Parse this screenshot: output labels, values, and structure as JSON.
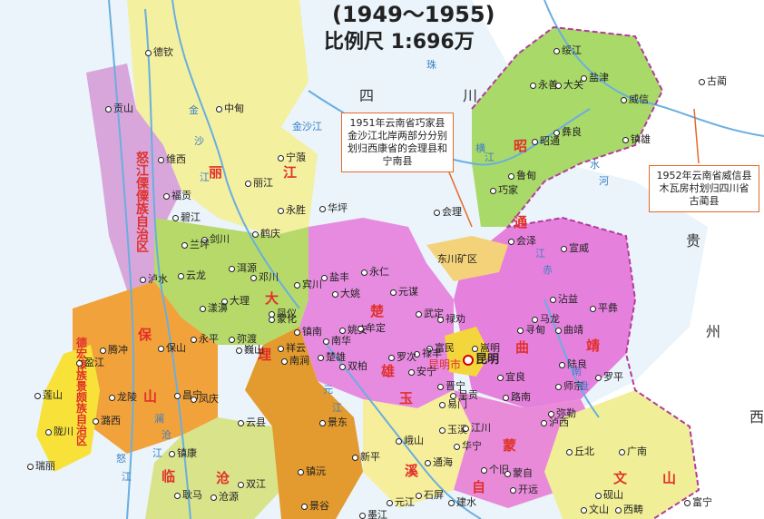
{
  "title": "(1949～1955)",
  "scale": "比例尺 1:696万",
  "notes": {
    "qiaojia": "1951年云南省巧家县金沙江北岸两部分分别划归西康省的会理县和宁南县",
    "weixin": "1952年云南省威信县木瓦房村划归四川省古蔺县"
  },
  "capital": "昆明",
  "regions": {
    "sichuan_si": "四",
    "sichuan_chuan": "川",
    "guizhou_gui": "贵",
    "guizhou_zhou": "州",
    "guangxi_xi": "西",
    "dongchuan": "东川矿区",
    "kunming_shi": "昆明市"
  },
  "district_chars": {
    "lijiang_li": "丽",
    "lijiang_jiang": "江",
    "nujiang": "怒江傈僳族自治区",
    "dali_da": "大",
    "dali_li": "理",
    "baoshan_bao": "保",
    "baoshan_shan": "山",
    "chuxiong_chu": "楚",
    "chuxiong_xiong": "雄",
    "zhaotong_zhao": "昭",
    "zhaotong_tong": "通",
    "qujing_qu": "曲",
    "qujing_jing": "靖",
    "yuxi_yu": "玉",
    "yuxi_xi": "溪",
    "mengzi_meng": "蒙",
    "mengzi_zi": "自",
    "wenshan_wen": "文",
    "wenshan_shan": "山",
    "lincang_lin": "临",
    "lincang_cang": "沧",
    "dehong": "德宏傣族景颇族自治区"
  },
  "counties": [
    "德钦",
    "中甸",
    "维西",
    "丽江",
    "宁蒗",
    "华坪",
    "永胜",
    "鹤庆",
    "剑川",
    "兰坪",
    "碧江",
    "福贡",
    "贡山",
    "泸水",
    "云龙",
    "洱源",
    "邓川",
    "宾川",
    "永仁",
    "大姚",
    "盐丰",
    "姚安",
    "牟定",
    "元谋",
    "武定",
    "禄劝",
    "大理",
    "漾濞",
    "凤仪",
    "祥云",
    "弥渡",
    "巍山",
    "永平",
    "保山",
    "腾冲",
    "龙陵",
    "盈江",
    "莲山",
    "陇川",
    "潞西",
    "瑞丽",
    "昌宁",
    "凤庆",
    "云县",
    "镇康",
    "耿马",
    "沧源",
    "双江",
    "景东",
    "镇沅",
    "景谷",
    "新平",
    "元江",
    "墨江",
    "峨山",
    "玉溪",
    "江川",
    "华宁",
    "通海",
    "建水",
    "石屏",
    "开远",
    "个旧",
    "蒙自",
    "弥勒",
    "路南",
    "宜良",
    "呈贡",
    "晋宁",
    "安宁",
    "富民",
    "嵩明",
    "寻甸",
    "马龙",
    "曲靖",
    "陆良",
    "罗平",
    "师宗",
    "泸西",
    "丘北",
    "广南",
    "砚山",
    "文山",
    "西畴",
    "富宁",
    "会泽",
    "巧家",
    "鲁甸",
    "昭通",
    "永善",
    "大关",
    "盐津",
    "绥江",
    "彝良",
    "镇雄",
    "威信",
    "宣威",
    "沾益",
    "平彝",
    "会理",
    "古蔺",
    "双柏",
    "楚雄",
    "南华",
    "镇南",
    "易门",
    "禄丰",
    "罗次",
    "南涧",
    "蒙化"
  ],
  "rivers": [
    "金",
    "沙",
    "江",
    "澜",
    "沧",
    "江",
    "怒",
    "江",
    "元",
    "江",
    "南",
    "盘",
    "江",
    "赤",
    "水",
    "河",
    "横",
    "江",
    "金沙江",
    "珠"
  ]
}
